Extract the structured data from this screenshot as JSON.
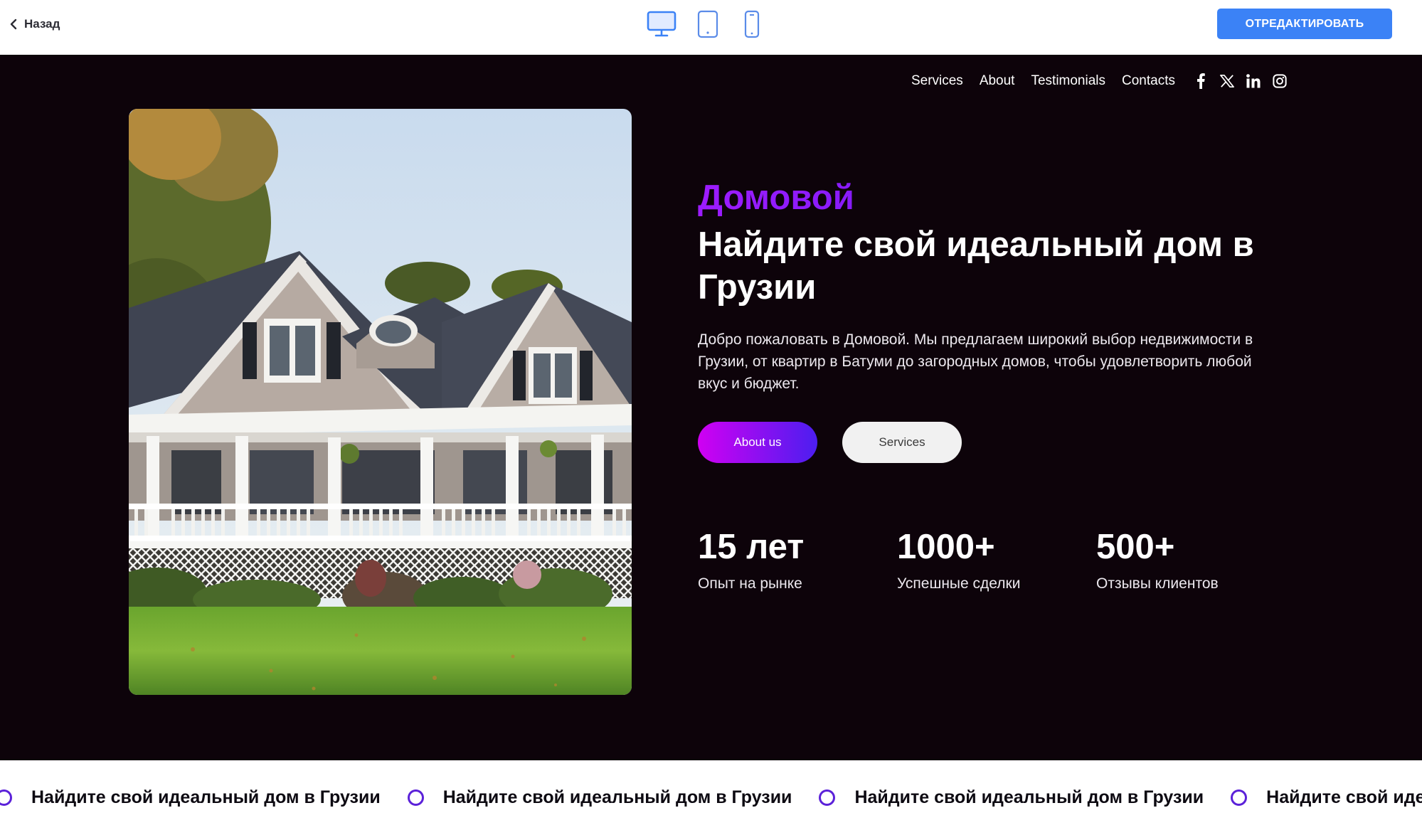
{
  "editor": {
    "back_label": "Назад",
    "edit_label": "ОТРЕДАКТИРОВАТЬ",
    "accent": "#3b82f6",
    "devices": [
      "desktop-icon",
      "tablet-icon",
      "mobile-icon"
    ],
    "active_device": "desktop"
  },
  "site": {
    "nav": [
      "Services",
      "About",
      "Testimonials",
      "Contacts"
    ],
    "socials": [
      "facebook-icon",
      "x-icon",
      "linkedin-icon",
      "instagram-icon"
    ],
    "hero": {
      "brand": "Домовой",
      "headline": "Найдите свой идеальный дом в Грузии",
      "lead": "Добро пожаловать в Домовой. Мы предлагаем широкий выбор недвижимости в Грузии, от квартир в Батуми до загородных домов, чтобы удовлетворить любой вкус и бюджет.",
      "primary_cta": "About us",
      "secondary_cta": "Services",
      "image": "house-photo"
    },
    "stats": [
      {
        "value": "15 лет",
        "label": "Опыт на рынке"
      },
      {
        "value": "1000+",
        "label": "Успешные сделки"
      },
      {
        "value": "500+",
        "label": "Отзывы клиентов"
      }
    ],
    "ticker": {
      "text": "Найдите свой идеальный дом в Грузии"
    },
    "colors": {
      "background": "#0d030a",
      "brand_gradient_start": "#9d1cff",
      "brand_gradient_end": "#4c17e8",
      "ticker_dot": "#5b21d9"
    }
  }
}
